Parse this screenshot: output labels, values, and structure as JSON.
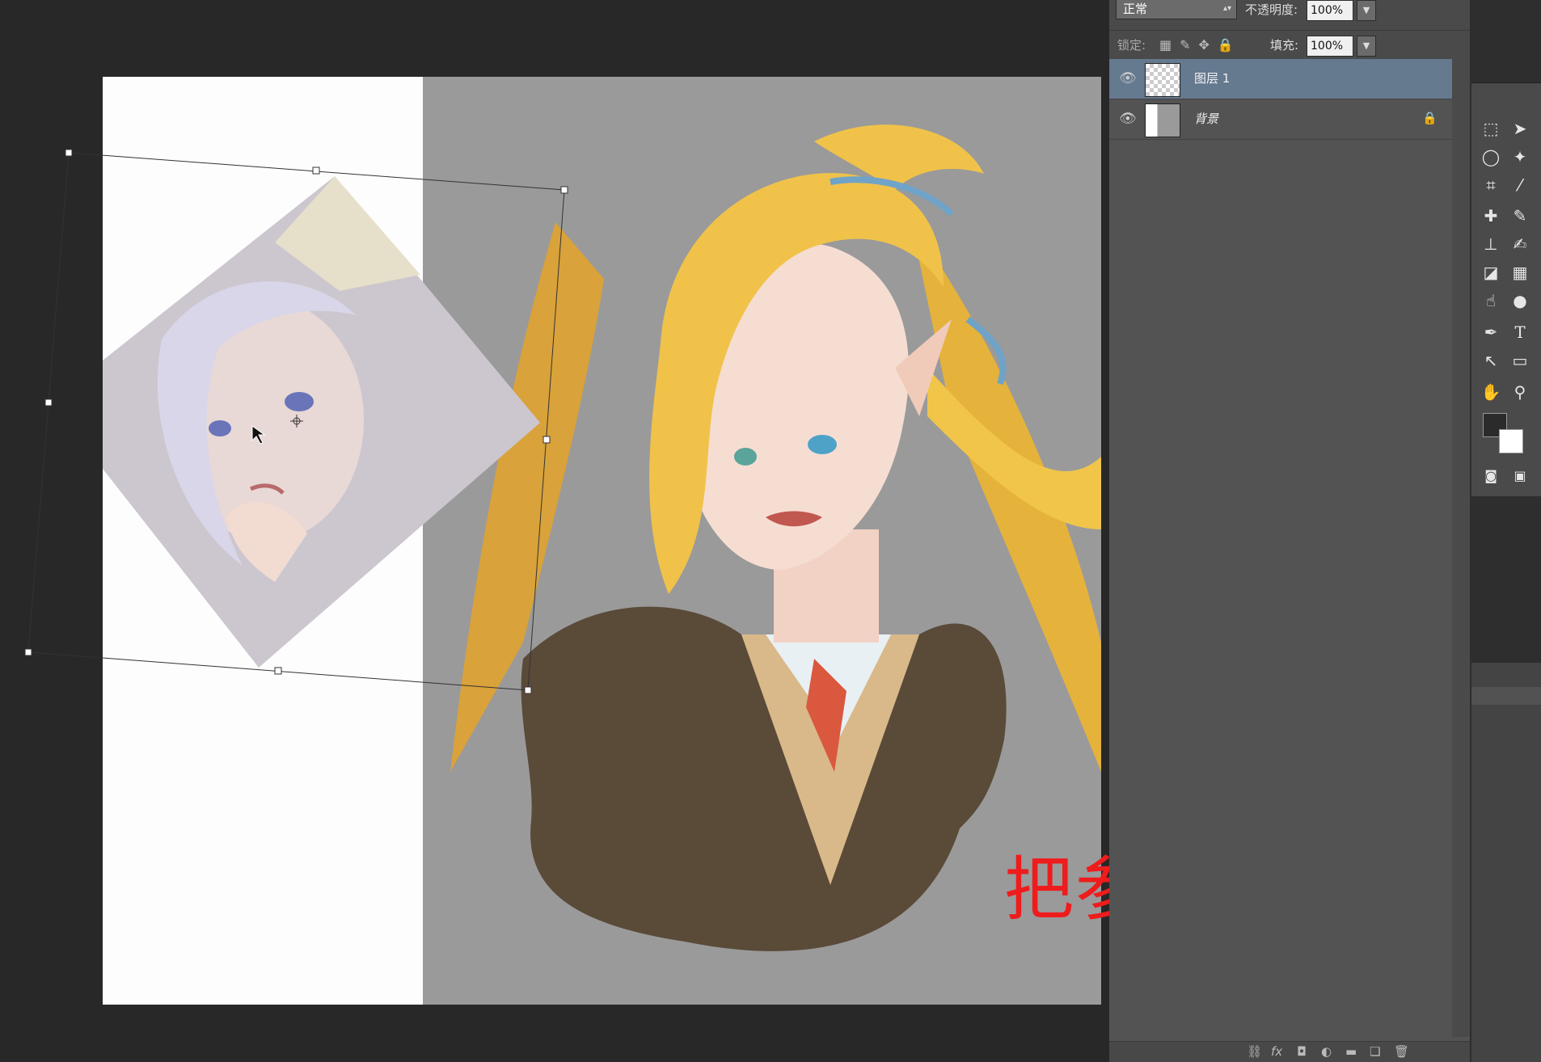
{
  "layers_panel": {
    "blend_mode": "正常",
    "opacity_label": "不透明度:",
    "opacity_value": "100%",
    "lock_label": "锁定:",
    "fill_label": "填充:",
    "fill_value": "100%",
    "layers": [
      {
        "name": "图层 1",
        "selected": true,
        "locked": false,
        "thumbnail": "transparent-checker"
      },
      {
        "name": "背景",
        "selected": false,
        "locked": true,
        "thumbnail": "background"
      }
    ]
  },
  "annotation": {
    "text": "把参考放在边上",
    "color": "#ee1c1c"
  },
  "toolbar": {
    "tools": [
      "marquee-icon",
      "move-icon",
      "lasso-icon",
      "magic-wand-icon",
      "crop-icon",
      "eyedropper-icon",
      "spot-heal-icon",
      "brush-icon",
      "stamp-icon",
      "history-brush-icon",
      "eraser-icon",
      "gradient-icon",
      "smudge-icon",
      "dodge-icon",
      "pen-icon",
      "type-icon",
      "path-select-icon",
      "shape-icon",
      "hand-icon",
      "zoom-icon"
    ],
    "type_tool_glyph": "T",
    "foreground_color": "#2b2b2b",
    "background_color": "#ffffff"
  },
  "colors": {
    "selection_highlight": "#65798f",
    "canvas_gray": "#9a9a9a",
    "workspace": "#282828"
  }
}
